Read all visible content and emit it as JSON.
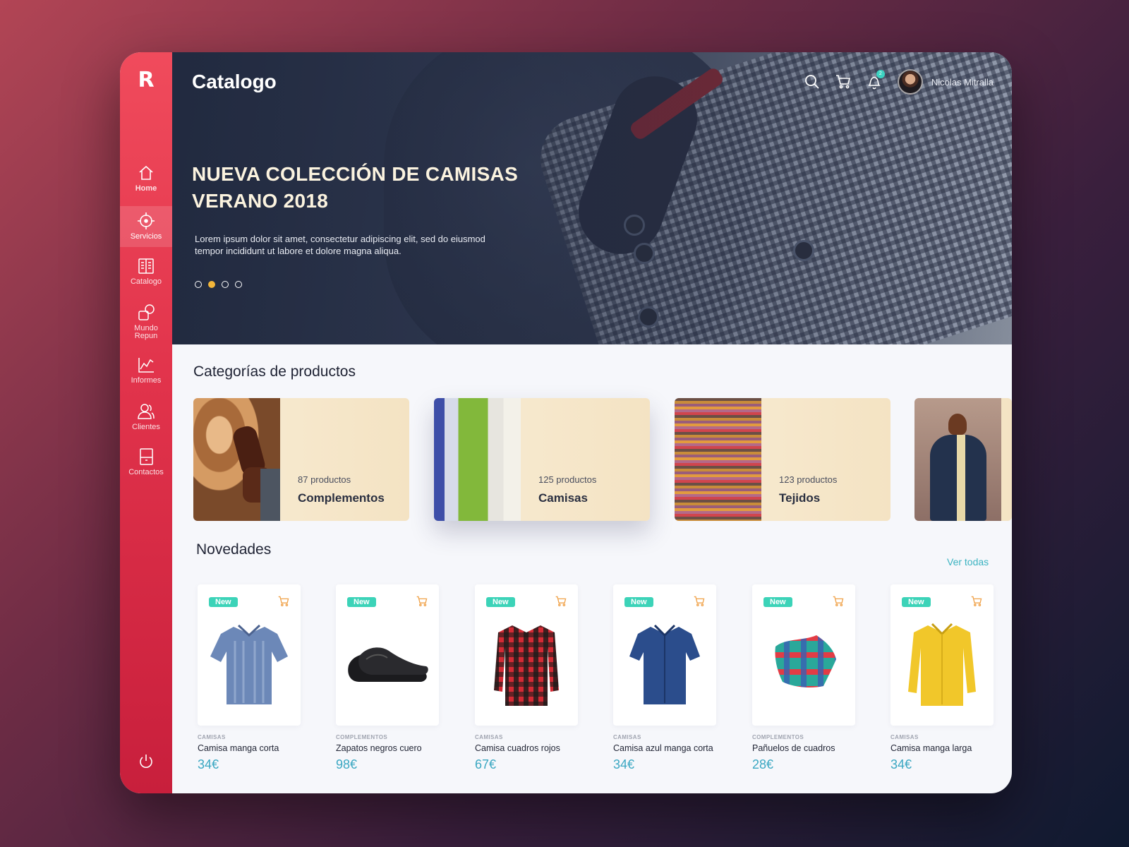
{
  "app": {
    "logo": "R",
    "page_title": "Catalogo"
  },
  "sidebar": {
    "items": [
      {
        "label": "Home",
        "icon": "home-icon"
      },
      {
        "label": "Servicios",
        "icon": "crosshair-icon",
        "active": true
      },
      {
        "label": "Catalogo",
        "icon": "book-icon"
      },
      {
        "label": "Mundo Repun",
        "icon": "shapes-icon"
      },
      {
        "label": "Informes",
        "icon": "chart-icon"
      },
      {
        "label": "Clientes",
        "icon": "users-icon"
      },
      {
        "label": "Contactos",
        "icon": "contacts-icon"
      }
    ],
    "power_icon": "power-icon"
  },
  "header": {
    "user_name": "Nicolas Mitralla",
    "notification_count": "2",
    "icons": [
      "search-icon",
      "cart-icon",
      "bell-icon"
    ]
  },
  "hero": {
    "title": "NUEVA COLECCIÓN DE CAMISAS VERANO 2018",
    "description": "Lorem ipsum dolor sit amet, consectetur adipiscing elit, sed do eiusmod tempor incididunt ut labore et dolore magna aliqua.",
    "slides": 4,
    "active_slide": 2
  },
  "categories": {
    "title": "Categorías de productos",
    "items": [
      {
        "count": "87 productos",
        "name": "Complementos"
      },
      {
        "count": "125 productos",
        "name": "Camisas"
      },
      {
        "count": "123 productos",
        "name": "Tejidos"
      },
      {
        "count": "",
        "name": ""
      }
    ]
  },
  "novedades": {
    "title": "Novedades",
    "see_all": "Ver todas",
    "tag": "New",
    "products": [
      {
        "category": "CAMISAS",
        "name": "Camisa manga corta",
        "price": "34€"
      },
      {
        "category": "COMPLEMENTOS",
        "name": "Zapatos negros cuero",
        "price": "98€"
      },
      {
        "category": "CAMISAS",
        "name": "Camisa cuadros rojos",
        "price": "67€"
      },
      {
        "category": "CAMISAS",
        "name": "Camisa azul manga corta",
        "price": "34€"
      },
      {
        "category": "COMPLEMENTOS",
        "name": "Pañuelos de cuadros",
        "price": "28€"
      },
      {
        "category": "CAMISAS",
        "name": "Camisa manga larga",
        "price": "34€"
      }
    ]
  },
  "colors": {
    "accent": "#e53a51",
    "price": "#3aa7c2",
    "new_tag": "#3cd3b8",
    "dot_active": "#f2b63a"
  }
}
